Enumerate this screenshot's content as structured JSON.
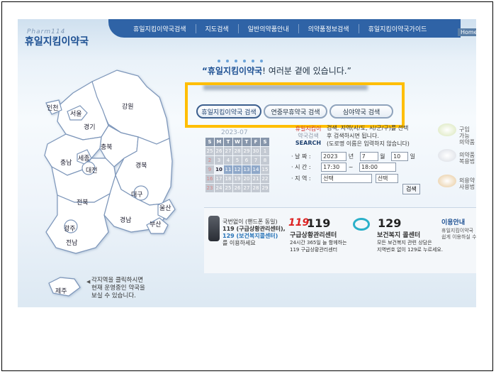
{
  "site": {
    "logo_sub": "Pharm114",
    "logo": "휴일지킴이약국",
    "nav": [
      "휴일지킴이약국검색",
      "지도검색",
      "일반의약품안내",
      "의약품정보검색",
      "휴일지킴이약국가이드"
    ],
    "home_links": "Home | L"
  },
  "slogan": {
    "brand": "“휴일지킴이약국",
    "rest": "! 여러분 곁에 있습니다.”"
  },
  "tabs": [
    "휴일지킴이약국 검색",
    "연중무휴약국 검색",
    "심야약국 검색"
  ],
  "regions": [
    "인천",
    "서울",
    "경기",
    "강원",
    "충남",
    "세종",
    "충북",
    "대전",
    "경북",
    "대구",
    "전북",
    "울산",
    "경남",
    "부산",
    "광주",
    "전남",
    "제주"
  ],
  "map_hint": [
    "각지역을 클릭하시면",
    "현재 운영중인 약국을",
    "보실 수 있습니다."
  ],
  "calendar": {
    "title": "2023-07",
    "weekdays": [
      "S",
      "M",
      "T",
      "W",
      "T",
      "F",
      "S"
    ],
    "rows": [
      [
        "25",
        "26",
        "27",
        "28",
        "29",
        "30",
        "1"
      ],
      [
        "2",
        "3",
        "4",
        "5",
        "6",
        "7",
        "8"
      ],
      [
        "9",
        "10",
        "11",
        "12",
        "13",
        "14",
        "15"
      ],
      [
        "16",
        "17",
        "18",
        "19",
        "20",
        "21",
        "22"
      ],
      [
        "23",
        "24",
        "25",
        "26",
        "27",
        "28",
        "29"
      ]
    ]
  },
  "search": {
    "side_red": "휴일지킴이",
    "side_gray": "약국검색",
    "side_bold": "SEARCH",
    "desc": [
      "검색, 지역(시/도, 시/군/구)를 선택",
      "후 검색하시면 됩니다.",
      "(도로명 이름은 입력하지 않습니다)"
    ],
    "date_label": "· 날 짜 :",
    "year": "2023",
    "year_unit": "년",
    "month": "7",
    "month_unit": "월",
    "day": "10",
    "day_unit": "일",
    "time_label": "· 시 간 :",
    "time_from": "17:30",
    "time_sep": "~",
    "time_to": "18:00",
    "region_label": "· 지 역 :",
    "region1": "선택",
    "region2": "선택",
    "button": "검색"
  },
  "side_links": [
    {
      "line1": "구입 가능",
      "line2": "의약품"
    },
    {
      "line1": "의약품",
      "line2": "복용법"
    },
    {
      "line1": "외용약",
      "line2": "사용법"
    }
  ],
  "bottom": {
    "phone_lines": [
      "국번없이 (핸드폰 동일)",
      "119 (구급상황관리센터),",
      "129 (보건복지콜센터)",
      "를 이용하세요"
    ],
    "logo119": "119",
    "big119": "119",
    "title119": "구급상황관리센터",
    "t119": [
      "24시간 365일 늘 함께하는",
      "119 구급상황관리센터"
    ],
    "big129": "129",
    "title129": "보건복지 콜센터",
    "t129": [
      "모든 보건복지 관련 상담은",
      "지역번호 없이 129로 누르세요."
    ]
  },
  "info": {
    "title": "이용안내",
    "lines": [
      "휴일지킴이약국",
      "쉽게 이용하실 수"
    ]
  },
  "colors": {
    "nav": "#2f63a6",
    "highlight": "#ffbe00",
    "map_fill": "#ffffff",
    "map_stroke": "#6f8fb8"
  }
}
